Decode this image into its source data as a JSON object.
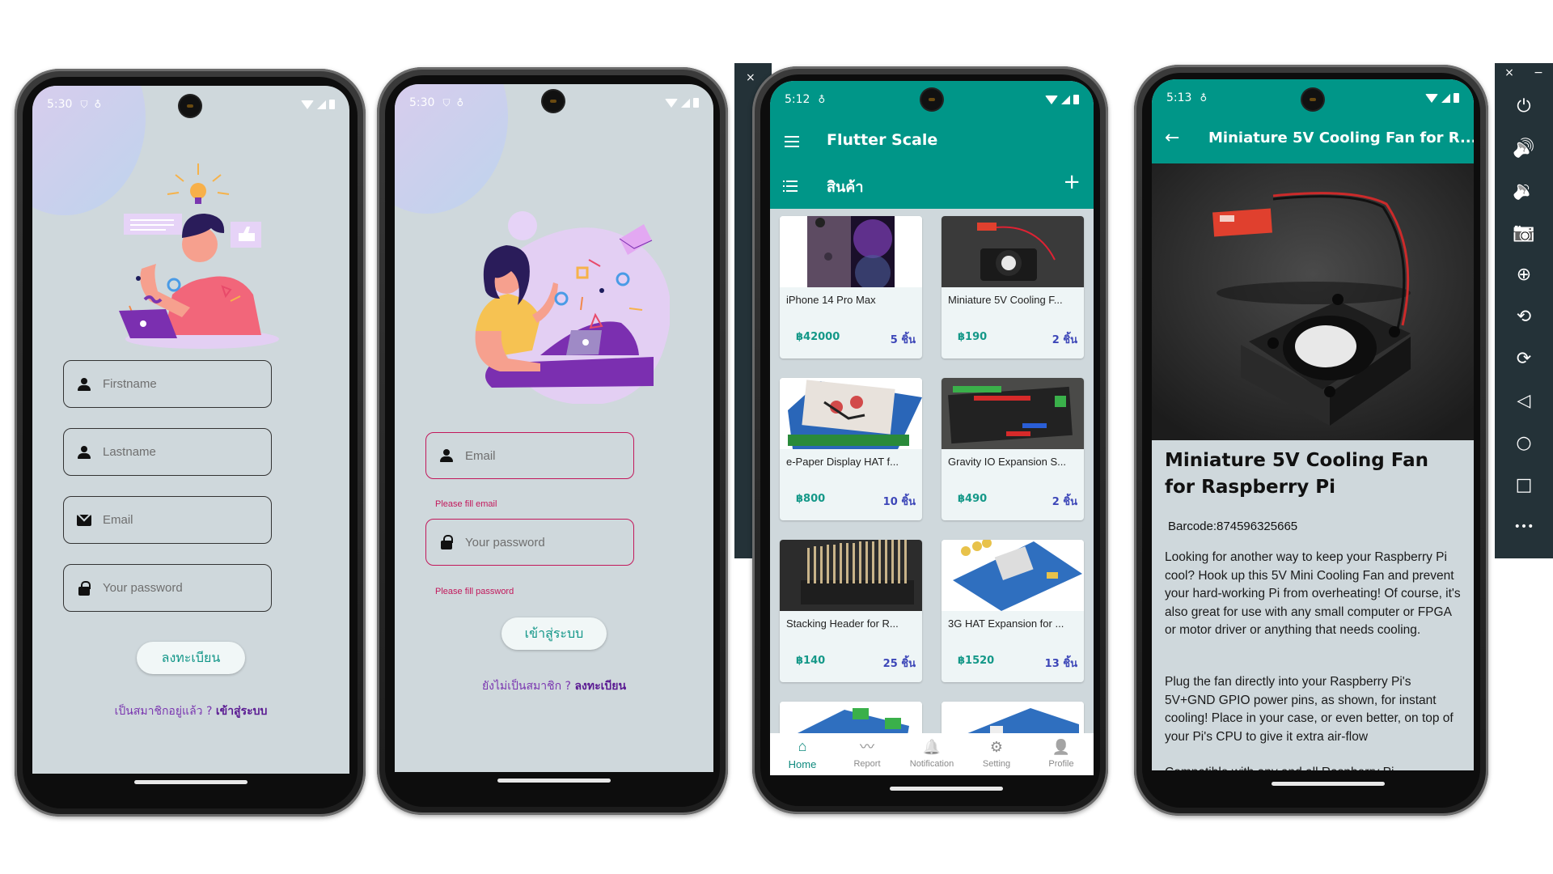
{
  "screens": {
    "register": {
      "status": {
        "time": "5:30"
      },
      "fields": [
        {
          "icon": "person-icon",
          "placeholder": "Firstname"
        },
        {
          "icon": "person-icon",
          "placeholder": "Lastname"
        },
        {
          "icon": "mail-icon",
          "placeholder": "Email"
        },
        {
          "icon": "lock-icon",
          "placeholder": "Your password"
        }
      ],
      "submit_label": "ลงทะเบียน",
      "footer_prefix": "เป็นสมาชิกอยู่แล้ว ? ",
      "footer_link": "เข้าสู่ระบบ"
    },
    "login": {
      "status": {
        "time": "5:30"
      },
      "fields": [
        {
          "icon": "person-icon",
          "placeholder": "Email",
          "error": "Please fill email"
        },
        {
          "icon": "lock-icon",
          "placeholder": "Your password",
          "error": "Please fill password"
        }
      ],
      "submit_label": "เข้าสู่ระบบ",
      "footer_prefix": "ยังไม่เป็นสมาชิก ? ",
      "footer_link": "ลงทะเบียน"
    },
    "products": {
      "status": {
        "time": "5:12"
      },
      "app_title": "Flutter Scale",
      "section_title": "สินค้า",
      "items": [
        {
          "name": "iPhone 14 Pro Max",
          "price": "฿42000",
          "qty": "5 ชิ้น"
        },
        {
          "name": "Miniature 5V Cooling F...",
          "price": "฿190",
          "qty": "2 ชิ้น"
        },
        {
          "name": "e-Paper Display HAT f...",
          "price": "฿800",
          "qty": "10 ชิ้น"
        },
        {
          "name": "Gravity IO Expansion S...",
          "price": "฿490",
          "qty": "2 ชิ้น"
        },
        {
          "name": "Stacking Header for R...",
          "price": "฿140",
          "qty": "25 ชิ้น"
        },
        {
          "name": "3G HAT Expansion for ...",
          "price": "฿1520",
          "qty": "13 ชิ้น"
        }
      ],
      "bottom_nav": [
        {
          "label": "Home",
          "icon": "⌂",
          "active": true
        },
        {
          "label": "Report",
          "icon": "〰",
          "active": false
        },
        {
          "label": "Notification",
          "icon": "🔔",
          "active": false
        },
        {
          "label": "Setting",
          "icon": "⚙",
          "active": false
        },
        {
          "label": "Profile",
          "icon": "👤",
          "active": false
        }
      ]
    },
    "detail": {
      "status": {
        "time": "5:13"
      },
      "app_title": "Miniature 5V Cooling Fan for R...",
      "title": "Miniature 5V Cooling Fan for Raspberry Pi",
      "barcode": "Barcode:874596325665",
      "paragraphs": [
        "Looking for another way to keep your Raspberry Pi cool? Hook up this 5V Mini Cooling Fan and prevent your hard-working Pi from overheating! Of course, it's also great for use with any small computer or FPGA or motor driver or anything that needs cooling.",
        "Plug the fan directly into your Raspberry Pi's 5V+GND GPIO power pins, as shown, for instant cooling! Place in your case, or even better, on top of your Pi's CPU to give it extra air-flow",
        "Compatible with any and all Raspberry Pi"
      ]
    }
  },
  "emulator_toolbar": {
    "close": "×",
    "minimize": "−",
    "buttons": [
      {
        "name": "power-button",
        "glyph": "⏻"
      },
      {
        "name": "volume-up-button",
        "glyph": "🔊"
      },
      {
        "name": "volume-down-button",
        "glyph": "🔉"
      },
      {
        "name": "screenshot-button",
        "glyph": "📷"
      },
      {
        "name": "zoom-button",
        "glyph": "⊕"
      },
      {
        "name": "rotate-left-button",
        "glyph": "⟲"
      },
      {
        "name": "rotate-right-button",
        "glyph": "⟳"
      },
      {
        "name": "back-button",
        "glyph": "◁"
      },
      {
        "name": "home-button",
        "glyph": "○"
      },
      {
        "name": "overview-button",
        "glyph": "□"
      },
      {
        "name": "more-button",
        "glyph": "•••"
      }
    ]
  },
  "colors": {
    "teal": "#009688",
    "error": "#c2185b",
    "purple": "#7a36b0",
    "price": "#149888",
    "qty": "#3d47b8",
    "screen_bg": "#cfd8dc"
  }
}
